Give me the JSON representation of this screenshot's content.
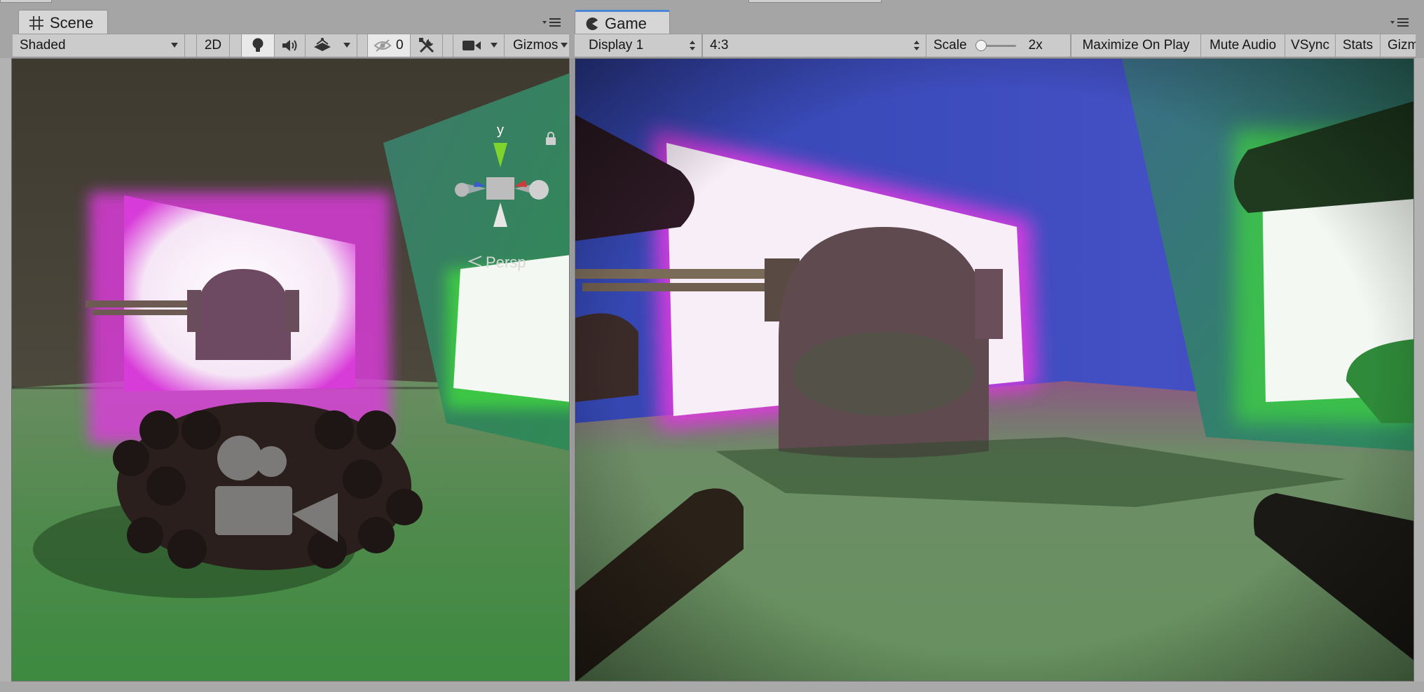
{
  "scene_tab": {
    "label": "Scene",
    "icon": "grid-icon"
  },
  "game_tab": {
    "label": "Game",
    "icon": "pacman-icon"
  },
  "scene_toolbar": {
    "draw_mode": "Shaded",
    "mode_2d": "2D",
    "hidden_count": "0",
    "gizmos": "Gizmos",
    "icons": [
      "lightbulb-icon",
      "speaker-icon",
      "effects-icon",
      "eye-hidden-icon",
      "tools-icon",
      "camera-icon"
    ]
  },
  "scene_view": {
    "gizmo_axis_label": "y",
    "projection_label": "Persp"
  },
  "game_toolbar": {
    "display": "Display 1",
    "aspect": "4:3",
    "scale_label": "Scale",
    "scale_value": "2x",
    "scale_slider_fraction": 0.0,
    "maximize": "Maximize On Play",
    "mute": "Mute Audio",
    "vsync": "VSync",
    "stats": "Stats",
    "gizmos": "Gizmo"
  },
  "colors": {
    "tab_accent": "#4a86d6",
    "toolbar_bg": "#cbcbcb",
    "magenta_light": "#e03be0",
    "green_light": "#3fd83f",
    "ground": "#5d8a5b"
  }
}
